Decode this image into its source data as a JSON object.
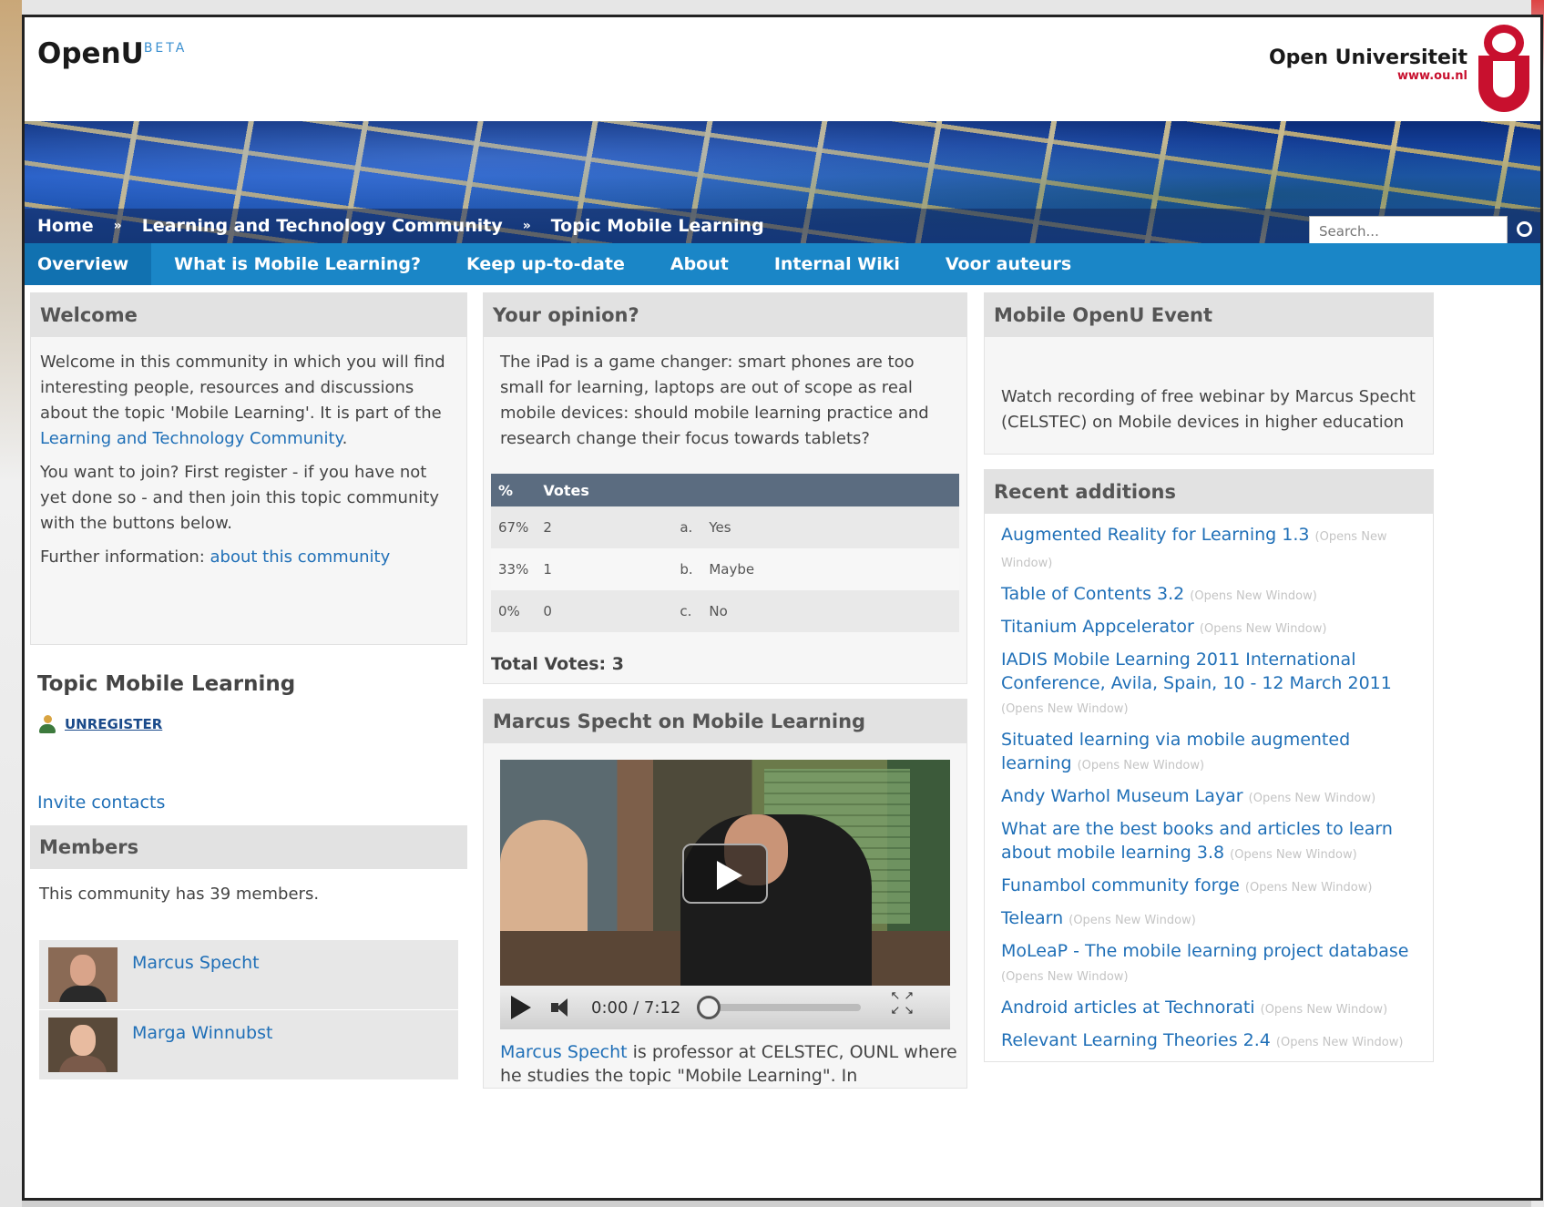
{
  "header": {
    "logo_text": "OpenU",
    "logo_badge": "BETA",
    "institution_name": "Open Universiteit",
    "institution_url": "www.ou.nl"
  },
  "breadcrumb": {
    "items": [
      "Home",
      "Learning and Technology Community",
      "Topic Mobile Learning"
    ],
    "separator": "»"
  },
  "search": {
    "placeholder": "Search..."
  },
  "nav": {
    "tabs": [
      "Overview",
      "What is Mobile Learning?",
      "Keep up-to-date",
      "About",
      "Internal Wiki",
      "Voor auteurs"
    ],
    "active": "Overview"
  },
  "welcome": {
    "title": "Welcome",
    "p1_text": "Welcome in this community in which you will find interesting people, resources and discussions about the topic 'Mobile Learning'. It is part of the ",
    "p1_link": "Learning and Technology Community",
    "p1_end": ".",
    "p2": "You want to join? First register - if you have not yet done so - and then join this topic community with the buttons below.",
    "p3_text": "Further information: ",
    "p3_link": "about this community"
  },
  "topic": {
    "title": "Topic Mobile Learning",
    "unregister": "UNREGISTER",
    "invite": "Invite contacts"
  },
  "members": {
    "title": "Members",
    "count_text": "This community has 39 members.",
    "list": [
      "Marcus Specht",
      "Marga Winnubst"
    ]
  },
  "poll": {
    "title": "Your opinion?",
    "question": "The iPad is a game changer: smart phones are too small for learning, laptops are out of scope as real mobile devices: should mobile learning practice and research change their focus towards tablets?",
    "headers": [
      "%",
      "Votes"
    ],
    "rows": [
      {
        "percent": "67%",
        "votes": "2",
        "letter": "a.",
        "answer": "Yes"
      },
      {
        "percent": "33%",
        "votes": "1",
        "letter": "b.",
        "answer": "Maybe"
      },
      {
        "percent": "0%",
        "votes": "0",
        "letter": "c.",
        "answer": "No"
      }
    ],
    "total": "Total Votes: 3"
  },
  "video_panel": {
    "title": "Marcus Specht on Mobile Learning",
    "time": "0:00 / 7:12",
    "progress": 0,
    "caption_link": "Marcus Specht",
    "caption_text": " is professor at CELSTEC, OUNL where he studies the topic \"Mobile Learning\". In"
  },
  "event": {
    "title": "Mobile OpenU Event",
    "text": "Watch recording of free webinar by Marcus Specht (CELSTEC) on Mobile devices in higher education"
  },
  "recent": {
    "title": "Recent additions",
    "new_window_note": "(Opens New Window)",
    "items": [
      "Augmented Reality for Learning 1.3",
      "Table of Contents 3.2",
      "Titanium Appcelerator",
      "IADIS Mobile Learning 2011 International Conference, Avila, Spain, 10 - 12 March 2011",
      "Situated learning via mobile augmented learning",
      "Andy Warhol Museum Layar",
      "What are the best books and articles to learn about mobile learning 3.8",
      "Funambol community forge",
      "Telearn",
      "MoLeaP - The mobile learning project database",
      "Android articles at Technorati",
      "Relevant Learning Theories 2.4"
    ]
  },
  "colors": {
    "nav_blue": "#1a86c7",
    "link_blue": "#1f6fb7",
    "ou_red": "#c8102e",
    "poll_header": "#5b6c80"
  }
}
